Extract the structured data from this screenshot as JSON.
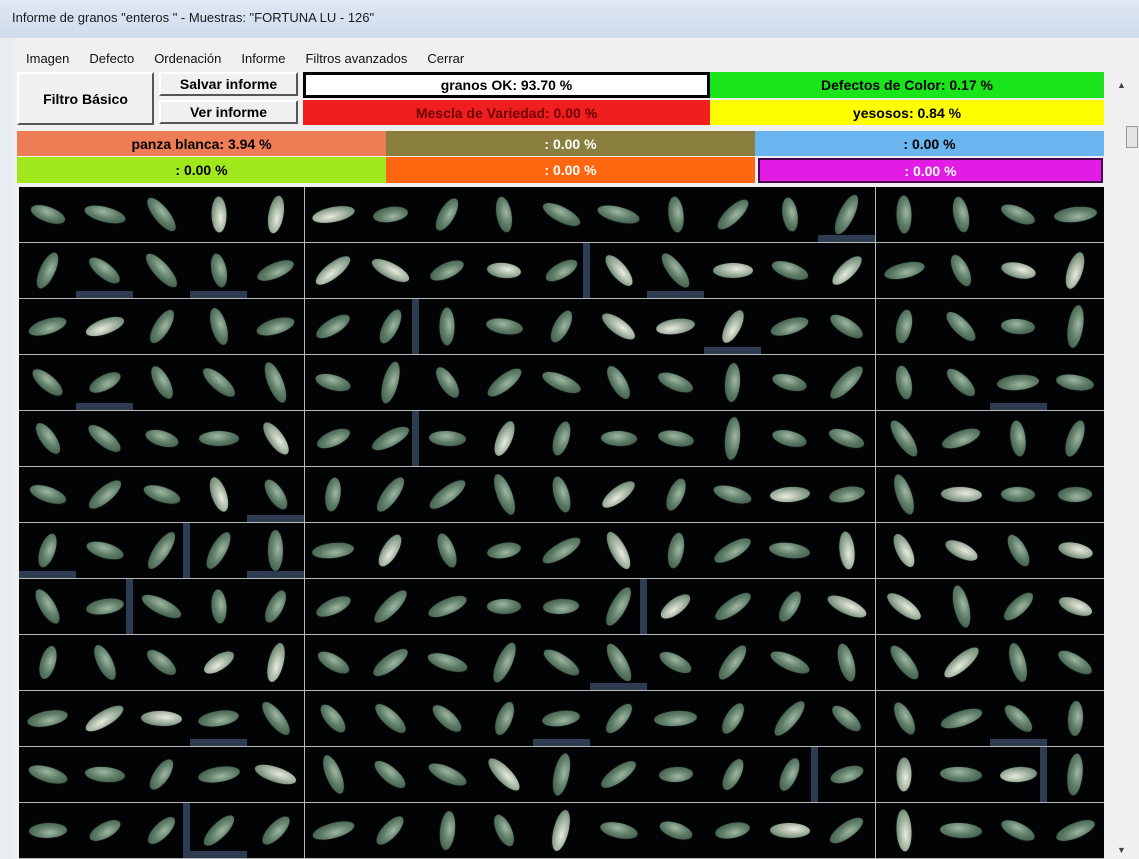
{
  "window": {
    "title": "Informe de granos \"enteros \" - Muestras: \"FORTUNA LU - 126\""
  },
  "menu": [
    {
      "label": "Imagen"
    },
    {
      "label": "Defecto"
    },
    {
      "label": "Ordenación"
    },
    {
      "label": "Informe"
    },
    {
      "label": "Filtros avanzados"
    },
    {
      "label": "Cerrar"
    }
  ],
  "buttons": {
    "filtro_basico": "Filtro Básico",
    "salvar_informe": "Salvar informe",
    "ver_informe": "Ver informe"
  },
  "stats": {
    "granos_ok": {
      "text": "granos OK: 93.70 %",
      "color": "#ffffff",
      "text_color": "#000000"
    },
    "defectos_color": {
      "text": "Defectos de Color:  0.17 %",
      "color": "#1ae51a",
      "text_color": "#000000"
    },
    "mescla_variedad": {
      "text": "Mescla de Variedad:  0.00 %",
      "color": "#f01e1e",
      "text_color": "#6e0000"
    },
    "yesosos": {
      "text": "yesosos:  0.84 %",
      "color": "#ffff00",
      "text_color": "#000000"
    },
    "panza_blanca": {
      "text": "panza blanca:  3.94 %",
      "color": "#ee7d55",
      "text_color": "#000000"
    },
    "empty_olive": {
      "text": ":  0.00 %",
      "color": "#8a7f3f",
      "text_color": "#ffffff"
    },
    "empty_sky": {
      "text": ":  0.00 %",
      "color": "#6ab4f0",
      "text_color": "#000000"
    },
    "empty_lime": {
      "text": ":  0.00 %",
      "color": "#a0e81c",
      "text_color": "#000000"
    },
    "empty_orange": {
      "text": ":  0.00 %",
      "color": "#ff6610",
      "text_color": "#ffffff"
    },
    "empty_magenta": {
      "text": ":  0.00 %",
      "color": "#e21ce4",
      "text_color": "#ffffff"
    }
  },
  "grid": {
    "rows": 12,
    "cols": 19,
    "grain_icon": "rice-grain-thumbnail"
  },
  "icons": {
    "scroll_up": "scroll-up-arrow-icon",
    "scroll_down": "scroll-down-arrow-icon"
  }
}
